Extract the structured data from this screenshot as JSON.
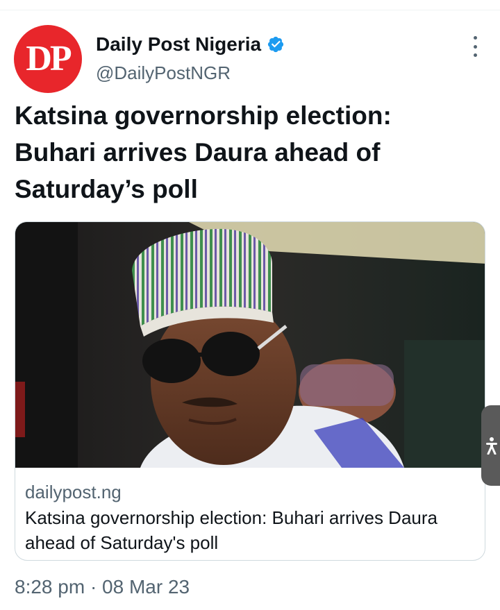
{
  "account": {
    "avatar_text": "DP",
    "display_name": "Daily Post Nigeria",
    "handle": "@DailyPostNGR",
    "verified": true
  },
  "tweet": {
    "text": "Katsina governorship election: Buhari arrives Daura ahead of Saturday’s poll",
    "timestamp": "8:28 pm · 08 Mar 23"
  },
  "card": {
    "domain": "dailypost.ng",
    "title": "Katsina governorship election: Buhari arrives Daura ahead of Saturday's poll"
  },
  "colors": {
    "avatar_bg": "#e8262b",
    "verified_blue": "#1d9bf0",
    "secondary_text": "#536471",
    "primary_text": "#0f1419",
    "card_border": "#cfd9de"
  },
  "icons": {
    "verified": "verified-badge-icon",
    "more": "more-options-icon",
    "accessibility": "accessibility-icon"
  }
}
